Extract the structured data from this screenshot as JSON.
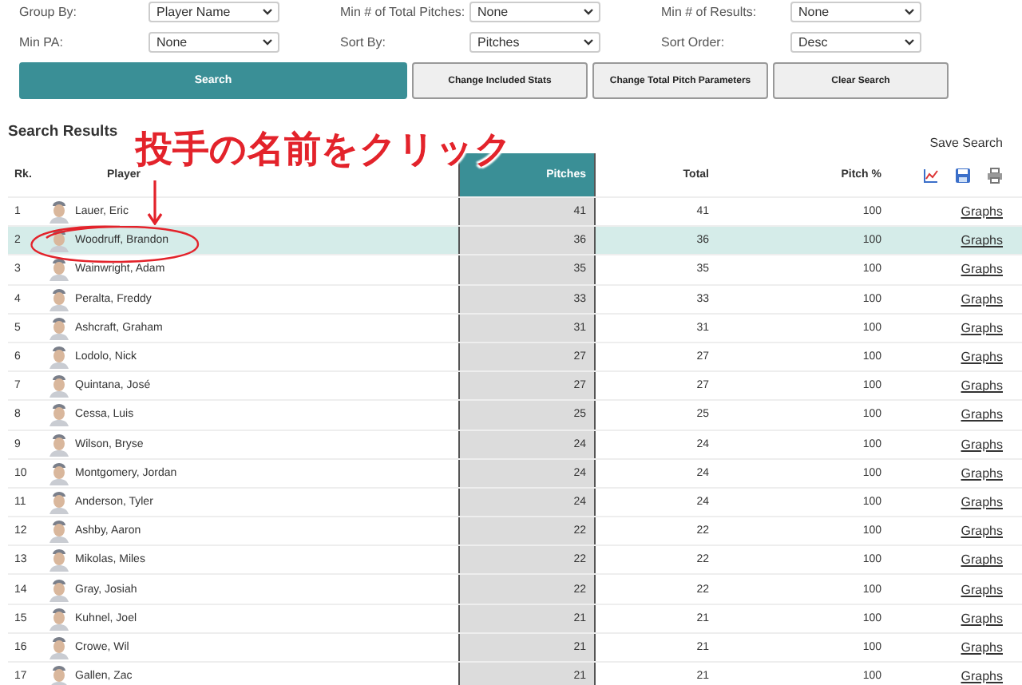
{
  "filters": [
    {
      "label": "Group By:",
      "value": "Player Name"
    },
    {
      "label": "Min # of Total Pitches:",
      "value": "None"
    },
    {
      "label": "Min # of Results:",
      "value": "None"
    },
    {
      "label": "Min PA:",
      "value": "None"
    },
    {
      "label": "Sort By:",
      "value": "Pitches"
    },
    {
      "label": "Sort Order:",
      "value": "Desc"
    }
  ],
  "buttons": [
    {
      "label": "Search",
      "kind": "primary"
    },
    {
      "label": "Change Included Stats",
      "kind": "secondary"
    },
    {
      "label": "Change Total Pitch Parameters",
      "kind": "secondary"
    },
    {
      "label": "Clear Search",
      "kind": "secondary"
    }
  ],
  "results": {
    "title": "Search Results",
    "save": "Save Search"
  },
  "annotation": {
    "text": "投手の名前をクリック"
  },
  "table": {
    "columns": [
      "Rk.",
      "Player",
      "Pitches",
      "Total",
      "Pitch %"
    ],
    "rows": [
      {
        "rank": "1",
        "player": "Lauer, Eric",
        "pitches": "41",
        "total": "41",
        "pct": "100",
        "link": "Graphs",
        "selected": false
      },
      {
        "rank": "2",
        "player": "Woodruff, Brandon",
        "pitches": "36",
        "total": "36",
        "pct": "100",
        "link": "Graphs",
        "selected": true
      },
      {
        "rank": "3",
        "player": "Wainwright, Adam",
        "pitches": "35",
        "total": "35",
        "pct": "100",
        "link": "Graphs",
        "selected": false
      },
      {
        "rank": "4",
        "player": "Peralta, Freddy",
        "pitches": "33",
        "total": "33",
        "pct": "100",
        "link": "Graphs",
        "selected": false
      },
      {
        "rank": "5",
        "player": "Ashcraft, Graham",
        "pitches": "31",
        "total": "31",
        "pct": "100",
        "link": "Graphs",
        "selected": false
      },
      {
        "rank": "6",
        "player": "Lodolo, Nick",
        "pitches": "27",
        "total": "27",
        "pct": "100",
        "link": "Graphs",
        "selected": false
      },
      {
        "rank": "7",
        "player": "Quintana, José",
        "pitches": "27",
        "total": "27",
        "pct": "100",
        "link": "Graphs",
        "selected": false
      },
      {
        "rank": "8",
        "player": "Cessa, Luis",
        "pitches": "25",
        "total": "25",
        "pct": "100",
        "link": "Graphs",
        "selected": false
      },
      {
        "rank": "9",
        "player": "Wilson, Bryse",
        "pitches": "24",
        "total": "24",
        "pct": "100",
        "link": "Graphs",
        "selected": false
      },
      {
        "rank": "10",
        "player": "Montgomery, Jordan",
        "pitches": "24",
        "total": "24",
        "pct": "100",
        "link": "Graphs",
        "selected": false
      },
      {
        "rank": "11",
        "player": "Anderson, Tyler",
        "pitches": "24",
        "total": "24",
        "pct": "100",
        "link": "Graphs",
        "selected": false
      },
      {
        "rank": "12",
        "player": "Ashby, Aaron",
        "pitches": "22",
        "total": "22",
        "pct": "100",
        "link": "Graphs",
        "selected": false
      },
      {
        "rank": "13",
        "player": "Mikolas, Miles",
        "pitches": "22",
        "total": "22",
        "pct": "100",
        "link": "Graphs",
        "selected": false
      },
      {
        "rank": "14",
        "player": "Gray, Josiah",
        "pitches": "22",
        "total": "22",
        "pct": "100",
        "link": "Graphs",
        "selected": false
      },
      {
        "rank": "15",
        "player": "Kuhnel, Joel",
        "pitches": "21",
        "total": "21",
        "pct": "100",
        "link": "Graphs",
        "selected": false
      },
      {
        "rank": "16",
        "player": "Crowe, Wil",
        "pitches": "21",
        "total": "21",
        "pct": "100",
        "link": "Graphs",
        "selected": false
      },
      {
        "rank": "17",
        "player": "Gallen, Zac",
        "pitches": "21",
        "total": "21",
        "pct": "100",
        "link": "Graphs",
        "selected": false
      }
    ]
  }
}
